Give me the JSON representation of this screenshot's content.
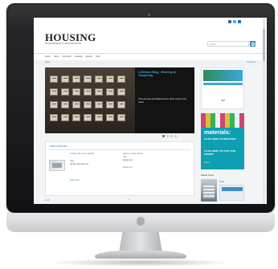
{
  "site": {
    "logo_text": "HOUSING",
    "tagline": "MANAGEMENT & MAINTENANCE",
    "search_placeholder": "Search",
    "nav": [
      "Home",
      "News",
      "Comment",
      "Features",
      "Events",
      "Jobs"
    ],
    "subbar_left": "Home",
    "subbar_right": "Subscribe"
  },
  "hero": {
    "title": "Letterbox Blog - Hearing on Tampering",
    "text": "The Housing and Maintenance team looks at the news."
  },
  "latest": {
    "heading": "Latest Articles",
    "article1": {
      "title": "Article title and subtitle",
      "date": "Date",
      "text": "Article summary text.",
      "more": "Read more"
    },
    "article2": {
      "title": "Quote of the Week",
      "date": "Date",
      "text": "Quote text.",
      "more": "Read more"
    },
    "bottom_link": "Link",
    "bottom_page": "1"
  },
  "sidebar": {
    "ad1_brand": "Ad",
    "ad2": {
      "headline": "materials:",
      "line1": "CLICK HERE TO REGISTER",
      "line2": "CLICK HERE TO VISIT OUR EXHIBIT",
      "date": "Dates"
    },
    "issue_title": "Latest Issue",
    "issue_link": "Read"
  },
  "colors": {
    "accent": "#3d8fc4",
    "hero_title": "#3aa7de",
    "ad_teal": "#0f9fb3"
  }
}
